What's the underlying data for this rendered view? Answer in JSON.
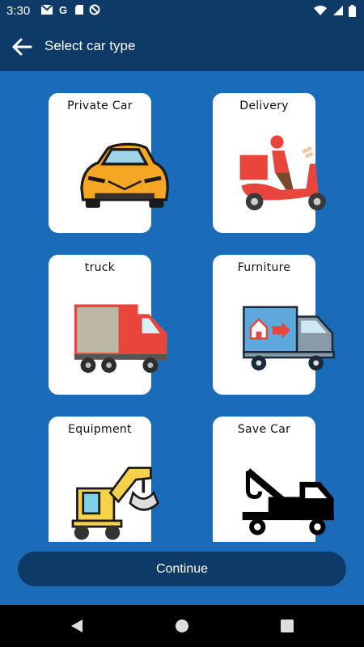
{
  "status": {
    "time": "3:30"
  },
  "appbar": {
    "title": "Select car type"
  },
  "cards": [
    {
      "label": "Private Car"
    },
    {
      "label": "Delivery"
    },
    {
      "label": "truck"
    },
    {
      "label": "Furniture"
    },
    {
      "label": "Equipment"
    },
    {
      "label": "Save Car"
    }
  ],
  "actions": {
    "continue_label": "Continue"
  },
  "colors": {
    "primary_dark": "#0d3a66",
    "background": "#1a6bb8"
  }
}
